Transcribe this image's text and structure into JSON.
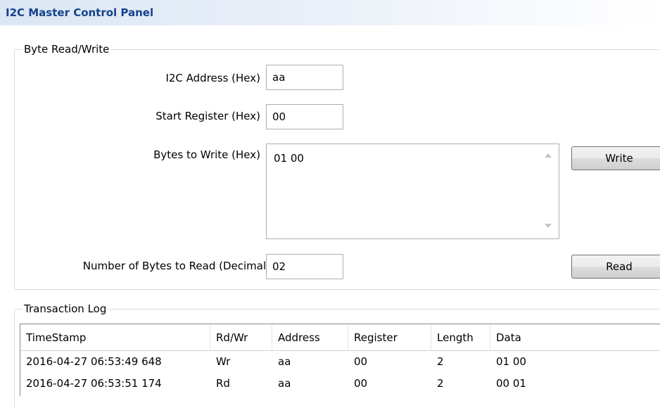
{
  "panel": {
    "title": "I2C Master Control Panel"
  },
  "byte_rw": {
    "group_label": "Byte Read/Write",
    "address_label": "I2C Address (Hex)",
    "address_value": "aa",
    "start_register_label": "Start Register (Hex)",
    "start_register_value": "00",
    "bytes_to_write_label": "Bytes to Write (Hex)",
    "bytes_to_write_value": "01 00",
    "write_button": "Write",
    "num_bytes_label": "Number of Bytes to Read (Decimal)",
    "num_bytes_value": "02",
    "read_button": "Read"
  },
  "log": {
    "group_label": "Transaction Log",
    "columns": [
      "TimeStamp",
      "Rd/Wr",
      "Address",
      "Register",
      "Length",
      "Data"
    ],
    "rows": [
      [
        "2016-04-27 06:53:49 648",
        "Wr",
        "aa",
        "00",
        "2",
        "01 00"
      ],
      [
        "2016-04-27 06:53:51 174",
        "Rd",
        "aa",
        "00",
        "2",
        "00 01"
      ]
    ]
  },
  "colors": {
    "title_color": "#15428b",
    "header_gradient_start": "#dbe6f4",
    "group_border": "#d5dfe5"
  },
  "icons": {
    "scroll_up": "scroll-up-arrow-icon",
    "scroll_down": "scroll-down-arrow-icon"
  }
}
